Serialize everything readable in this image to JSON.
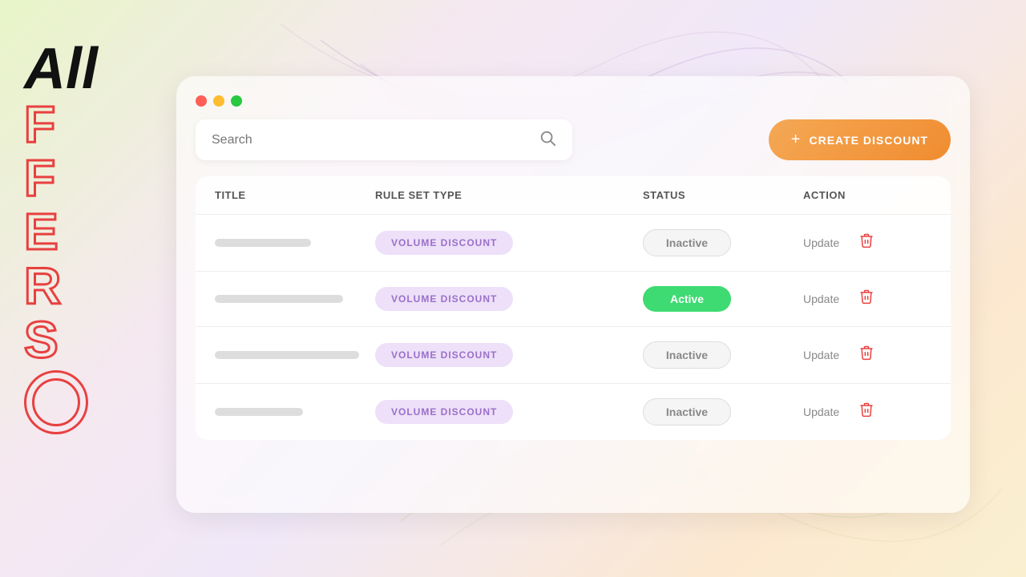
{
  "background": {
    "colors": [
      "#e8f5c8",
      "#f5e8f0",
      "#f0e8f8",
      "#fce8d0"
    ]
  },
  "side": {
    "all_text": "All",
    "letters": [
      "F",
      "F",
      "E",
      "R",
      "S"
    ],
    "circle": true
  },
  "window": {
    "dots": [
      "red",
      "yellow",
      "green"
    ]
  },
  "search": {
    "placeholder": "Search"
  },
  "create_button": {
    "label": "CREATE DISCOUNT",
    "plus": "+"
  },
  "table": {
    "headers": [
      {
        "key": "title",
        "label": "TITLE"
      },
      {
        "key": "rule_set_type",
        "label": "RULE SET TYPE"
      },
      {
        "key": "status",
        "label": "STATUS"
      },
      {
        "key": "action",
        "label": "ACTION"
      }
    ],
    "rows": [
      {
        "title_width": 120,
        "rule_set": "VOLUME DISCOUNT",
        "status": "Inactive",
        "status_type": "inactive",
        "action_update": "Update"
      },
      {
        "title_width": 160,
        "rule_set": "VOLUME DISCOUNT",
        "status": "Active",
        "status_type": "active",
        "action_update": "Update"
      },
      {
        "title_width": 180,
        "rule_set": "VOLUME DISCOUNT",
        "status": "Inactive",
        "status_type": "inactive",
        "action_update": "Update"
      },
      {
        "title_width": 110,
        "rule_set": "VOLUME DISCOUNT",
        "status": "Inactive",
        "status_type": "inactive",
        "action_update": "Update"
      }
    ]
  }
}
